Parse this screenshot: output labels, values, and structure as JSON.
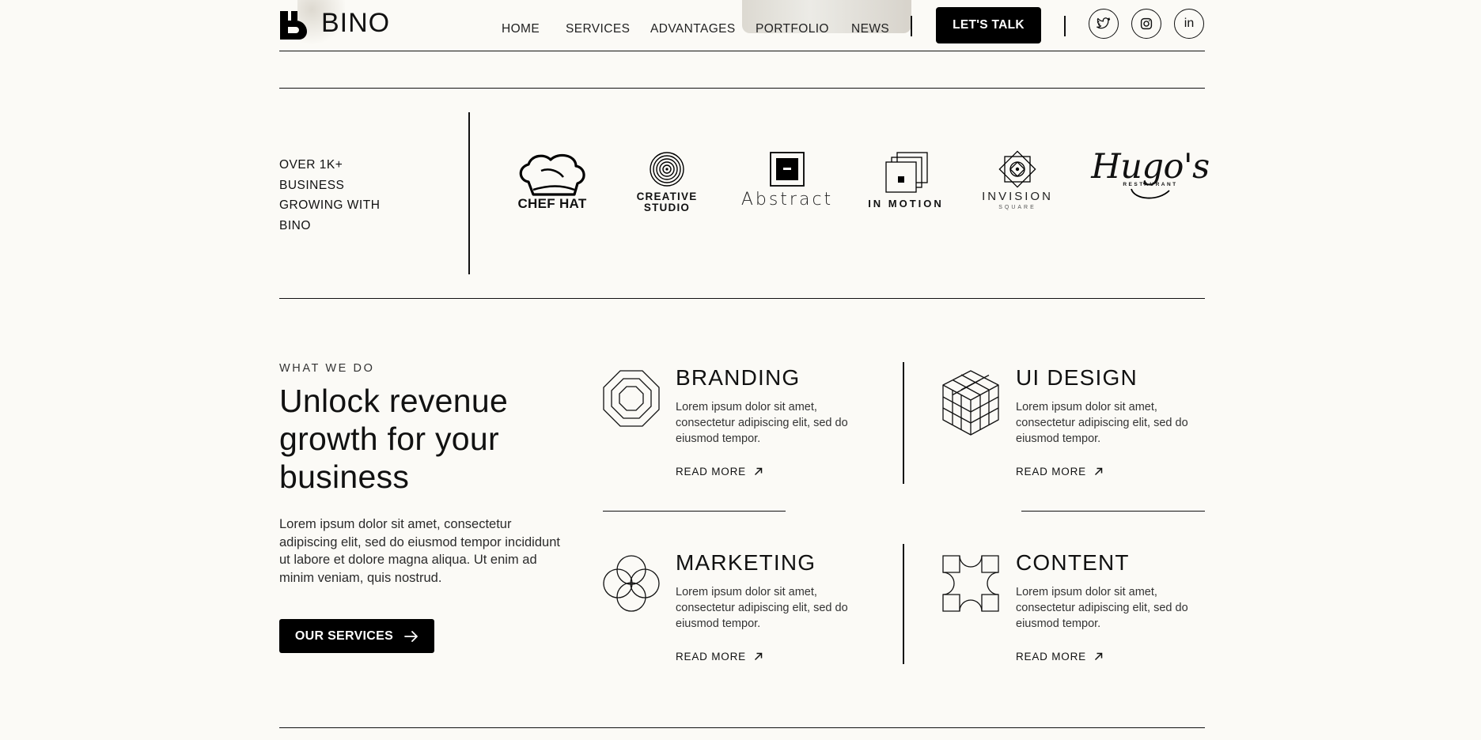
{
  "brand": {
    "name": "BINO"
  },
  "nav": {
    "links": [
      "HOME",
      "SERVICES",
      "ADVANTAGES",
      "PORTFOLIO",
      "NEWS"
    ],
    "cta": "LET'S TALK",
    "social": [
      "twitter-icon",
      "instagram-icon",
      "linkedin-icon"
    ]
  },
  "clients": {
    "tagline_lines": [
      "OVER 1K+",
      "BUSINESS",
      "GROWING WITH",
      "BINO"
    ],
    "logos": [
      {
        "name": "CHEF HAT"
      },
      {
        "name_line1": "CREATIVE",
        "name_line2": "STUDIO"
      },
      {
        "name": "Abstract"
      },
      {
        "name": "IN MOTION"
      },
      {
        "name": "INVISION",
        "sub": "SQUARE"
      },
      {
        "name": "Hugo's",
        "sub": "RESTAURANT"
      }
    ]
  },
  "what_we_do": {
    "eyebrow": "WHAT WE DO",
    "headline": "Unlock revenue growth for your business",
    "description": "Lorem ipsum dolor sit amet, consectetur adipiscing elit, sed do eiusmod tempor incididunt ut labore et dolore magna aliqua. Ut enim ad minim veniam, quis nostrud.",
    "button": "OUR SERVICES",
    "services": [
      {
        "title": "BRANDING",
        "text": "Lorem ipsum dolor sit amet, consectetur adipiscing elit, sed do eiusmod tempor.",
        "link": "READ MORE"
      },
      {
        "title": "UI DESIGN",
        "text": "Lorem ipsum dolor sit amet, consectetur adipiscing elit, sed do eiusmod tempor.",
        "link": "READ MORE"
      },
      {
        "title": "MARKETING",
        "text": "Lorem ipsum dolor sit amet, consectetur adipiscing elit, sed do eiusmod tempor.",
        "link": "READ MORE"
      },
      {
        "title": "CONTENT",
        "text": "Lorem ipsum dolor sit amet, consectetur adipiscing elit, sed do eiusmod tempor.",
        "link": "READ MORE"
      }
    ]
  }
}
